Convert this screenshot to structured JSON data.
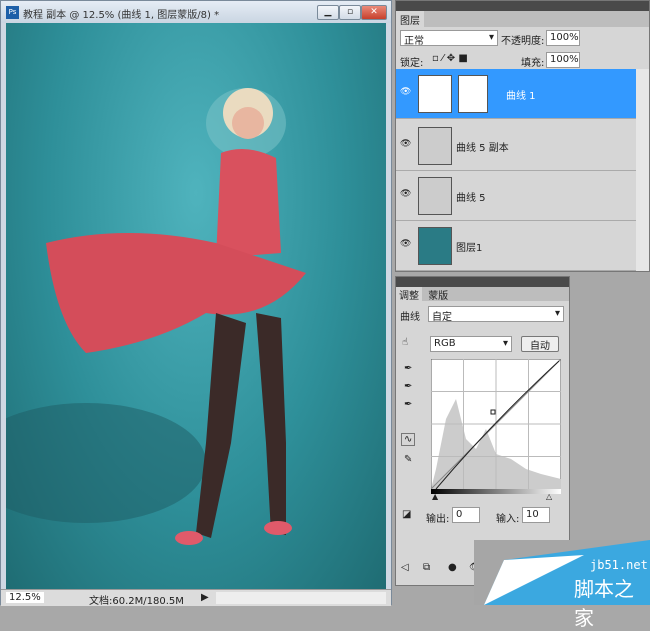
{
  "document": {
    "title": "教程 副本 @ 12.5% (曲线 1, 图层蒙版/8) *",
    "zoom": "12.5%",
    "doc_size": "文档:60.2M/180.5M"
  },
  "layers_panel": {
    "tab": "图层",
    "blend_mode": "正常",
    "opacity_label": "不透明度:",
    "opacity": "100%",
    "lock_label": "锁定:",
    "fill_label": "填充:",
    "fill": "100%",
    "layers": [
      {
        "name": "曲线 1",
        "selected": true
      },
      {
        "name": "曲线 5 副本"
      },
      {
        "name": "曲线 5"
      },
      {
        "name": "图层1"
      }
    ]
  },
  "adjustments_panel": {
    "tabs": [
      "调整",
      "蒙版"
    ],
    "type_label": "曲线",
    "preset": "自定",
    "channel": "RGB",
    "auto_button": "自动",
    "output_label": "输出:",
    "output_value": "0",
    "input_label": "输入:",
    "input_value": "10"
  },
  "watermark": {
    "site": "jb51.net",
    "name": "脚本之家"
  },
  "colors": {
    "selection": "#3399ff",
    "canvas": "#2e8f99",
    "dress": "#d9515e"
  }
}
